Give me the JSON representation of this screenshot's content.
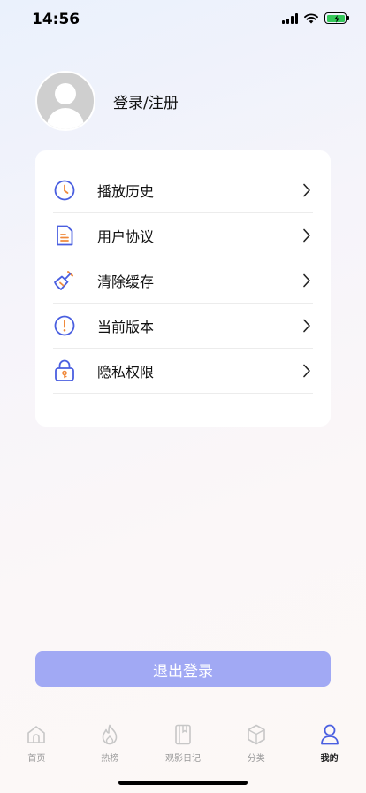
{
  "status_bar": {
    "time": "14:56"
  },
  "profile": {
    "login_label": "登录/注册"
  },
  "menu": {
    "items": [
      {
        "label": "播放历史",
        "icon": "clock-icon"
      },
      {
        "label": "用户协议",
        "icon": "document-icon"
      },
      {
        "label": "清除缓存",
        "icon": "broom-icon"
      },
      {
        "label": "当前版本",
        "icon": "info-exclamation-icon"
      },
      {
        "label": "隐私权限",
        "icon": "lock-icon"
      }
    ]
  },
  "logout": {
    "label": "退出登录"
  },
  "tabbar": {
    "tabs": [
      {
        "label": "首页",
        "icon": "home-icon",
        "active": false
      },
      {
        "label": "热榜",
        "icon": "flame-icon",
        "active": false
      },
      {
        "label": "观影日记",
        "icon": "book-icon",
        "active": false
      },
      {
        "label": "分类",
        "icon": "box-icon",
        "active": false
      },
      {
        "label": "我的",
        "icon": "user-icon",
        "active": true
      }
    ]
  },
  "colors": {
    "accent": "#4a5fe0",
    "orange": "#f08a3c",
    "logout_bg": "#a1a9f4"
  }
}
